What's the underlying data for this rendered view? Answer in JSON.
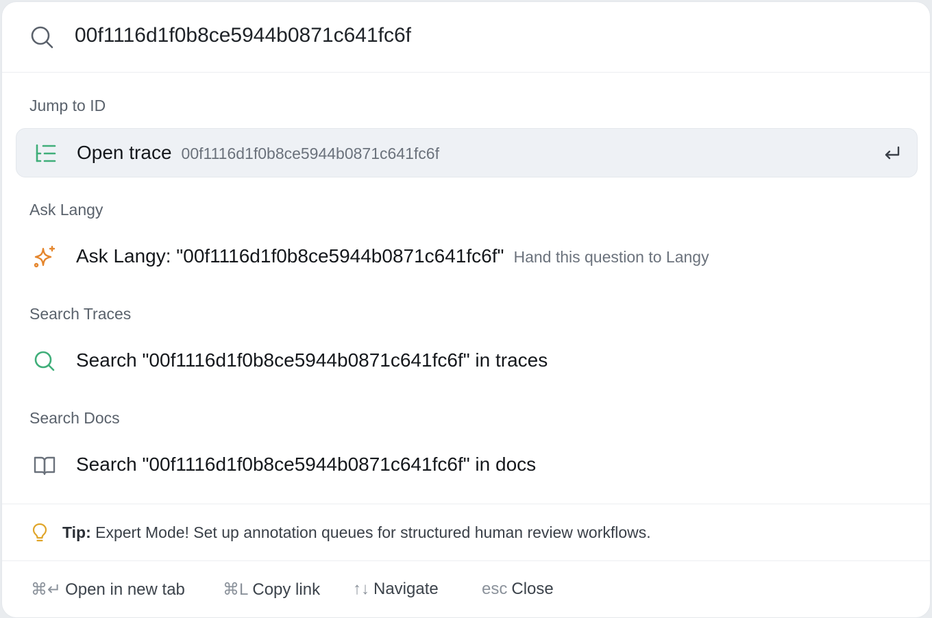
{
  "search": {
    "value": "00f1116d1f0b8ce5944b0871c641fc6f"
  },
  "sections": [
    {
      "heading": "Jump to ID",
      "item": {
        "icon": "trace-tree-icon",
        "title": "Open trace",
        "subtitle": "00f1116d1f0b8ce5944b0871c641fc6f",
        "selected": true,
        "shortcut_icon": "enter-icon"
      }
    },
    {
      "heading": "Ask Langy",
      "item": {
        "icon": "sparkles-icon",
        "title": "Ask Langy: \"00f1116d1f0b8ce5944b0871c641fc6f\"",
        "subtitle": "Hand this question to Langy"
      }
    },
    {
      "heading": "Search Traces",
      "item": {
        "icon": "search-icon",
        "title": "Search \"00f1116d1f0b8ce5944b0871c641fc6f\" in traces"
      }
    },
    {
      "heading": "Search Docs",
      "item": {
        "icon": "book-icon",
        "title": "Search \"00f1116d1f0b8ce5944b0871c641fc6f\" in docs"
      }
    }
  ],
  "tip": {
    "icon": "lightbulb-icon",
    "label": "Tip:",
    "text": "Expert Mode! Set up annotation queues for structured human review workflows."
  },
  "footer": {
    "hints": [
      {
        "keys": "⌘↵",
        "label": "Open in new tab"
      },
      {
        "keys": "⌘L",
        "label": "Copy link"
      },
      {
        "keys": "↑↓",
        "label": "Navigate"
      },
      {
        "keys": "esc",
        "label": "Close"
      }
    ]
  },
  "colors": {
    "green_accent": "#3fae79",
    "orange_accent": "#e5862d",
    "tip_yellow": "#e0a52a",
    "selected_row_bg": "#eef1f5"
  }
}
